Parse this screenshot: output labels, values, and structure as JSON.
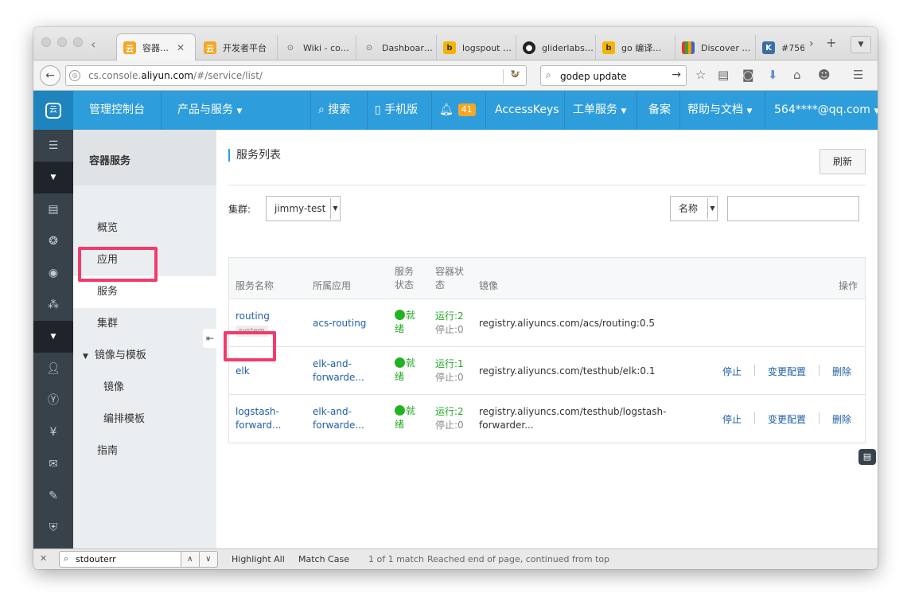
{
  "browser": {
    "tabs": [
      {
        "label": "容器…",
        "icon": "aliyun-favicon",
        "active": true
      },
      {
        "label": "开发者平台",
        "icon": "aliyun-favicon"
      },
      {
        "label": "Wiki - co…",
        "icon": "wolf-favicon"
      },
      {
        "label": "Dashboar…",
        "icon": "wolf-favicon"
      },
      {
        "label": "logspout …",
        "icon": "bing-favicon"
      },
      {
        "label": "gliderlabs…",
        "icon": "github-favicon"
      },
      {
        "label": "go 编译…",
        "icon": "bing-favicon"
      },
      {
        "label": "Discover …",
        "icon": "kibana-favicon"
      },
      {
        "label": "#756",
        "icon": "k-favicon"
      }
    ],
    "url_prefix": "cs.console.",
    "url_domain": "aliyun.com",
    "url_suffix": "/#/service/list/",
    "search_value": "godep update"
  },
  "console_header": {
    "console_label": "管理控制台",
    "products_label": "产品与服务",
    "search_label": "搜索",
    "mobile_label": "手机版",
    "notification_count": "41",
    "accesskeys_label": "AccessKeys",
    "tickets_label": "工单服务",
    "beian_label": "备案",
    "help_label": "帮助与文档",
    "user_label": "564****@qq.com"
  },
  "subnav": {
    "title": "容器服务",
    "items": {
      "overview": "概览",
      "apps": "应用",
      "services": "服务",
      "clusters": "集群",
      "images_templates": "镜像与模板",
      "images": "镜像",
      "templates": "编排模板",
      "guide": "指南"
    }
  },
  "main": {
    "title": "服务列表",
    "refresh_label": "刷新",
    "cluster_label": "集群:",
    "cluster_value": "jimmy-test",
    "filter_by": "名称",
    "table": {
      "headers": {
        "name": "服务名称",
        "app": "所属应用",
        "status_l1": "服务",
        "status_l2": "状态",
        "container_l1": "容器状",
        "container_l2": "态",
        "image": "镜像",
        "actions": "操作"
      },
      "rows": [
        {
          "name": "routing",
          "tag": "system",
          "app": "acs-routing",
          "status_l1": "就",
          "status_l2": "绪",
          "running": "运行:2",
          "stopped": "停止:0",
          "image_l1": "registry.aliyuncs.com/acs/routing:0.5",
          "image_l2": ""
        },
        {
          "name": "elk",
          "app_l1": "elk-and-",
          "app_l2": "forwarde...",
          "status_l1": "就",
          "status_l2": "绪",
          "running": "运行:1",
          "stopped": "停止:0",
          "image_l1": "registry.aliyuncs.com/testhub/elk:0.1",
          "image_l2": "",
          "stop": "停止",
          "config": "变更配置",
          "delete": "删除"
        },
        {
          "name_l1": "logstash-",
          "name_l2": "forward...",
          "app_l1": "elk-and-",
          "app_l2": "forwarde...",
          "status_l1": "就",
          "status_l2": "绪",
          "running": "运行:2",
          "stopped": "停止:0",
          "image_l1": "registry.aliyuncs.com/testhub/logstash-",
          "image_l2": "forwarder...",
          "stop": "停止",
          "config": "变更配置",
          "delete": "删除"
        }
      ]
    }
  },
  "findbar": {
    "query": "stdouterr",
    "highlight_all": "Highlight All",
    "match_case": "Match Case",
    "match_count": "1 of 1 match",
    "status": "Reached end of page, continued from top"
  },
  "colors": {
    "header_blue": "#2e9ddb",
    "sidebar_dark": "#38424b",
    "highlight_pink": "#f23b6b",
    "status_green": "#22b322",
    "link_blue": "#1f5fa8"
  }
}
